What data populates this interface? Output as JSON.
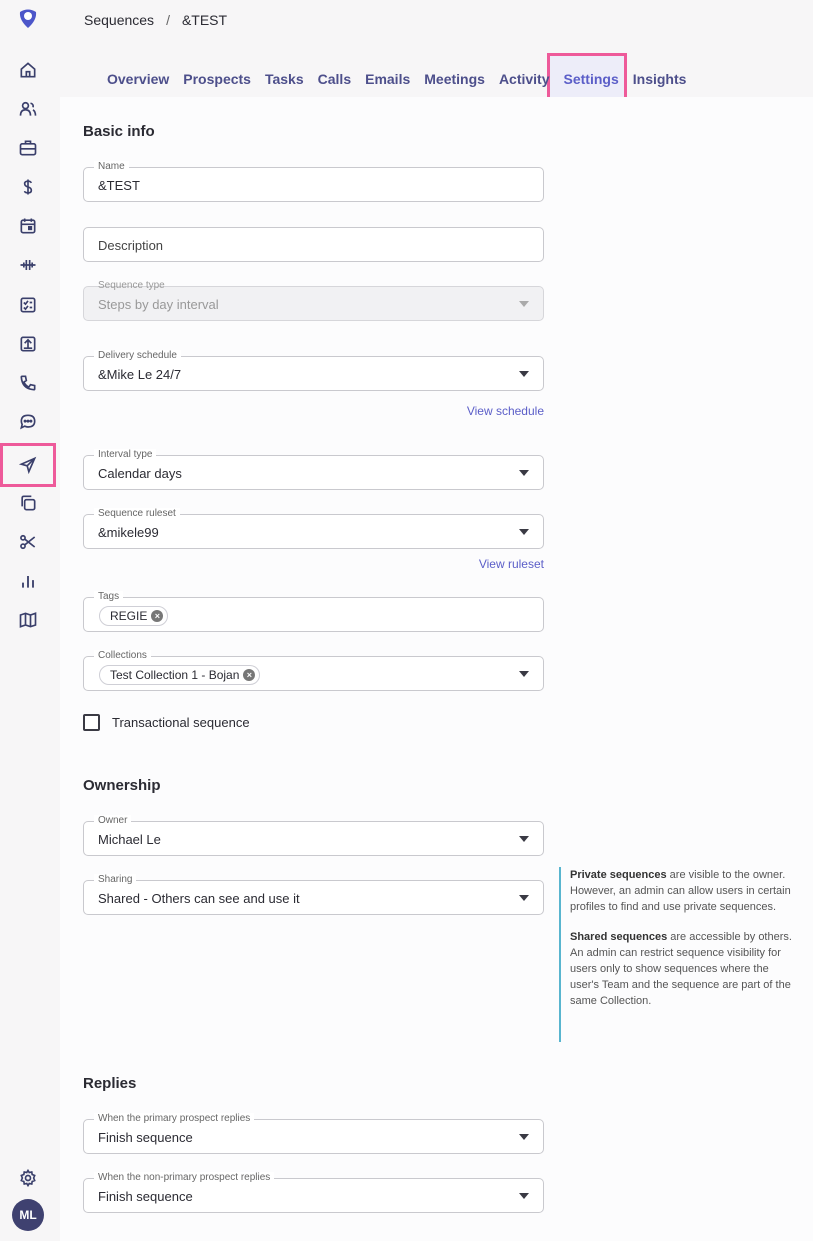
{
  "breadcrumb": {
    "root": "Sequences",
    "separator": "/",
    "current": "&TEST"
  },
  "tabs": [
    "Overview",
    "Prospects",
    "Tasks",
    "Calls",
    "Emails",
    "Meetings",
    "Activity",
    "Settings",
    "Insights"
  ],
  "active_tab": "Settings",
  "rail": {
    "icons": [
      "home-icon",
      "people-icon",
      "briefcase-icon",
      "dollar-icon",
      "calendar-icon",
      "waveform-icon",
      "checklist-icon",
      "upload-icon",
      "phone-icon",
      "chat-icon",
      "send-icon",
      "copy-icon",
      "scissors-icon",
      "bar-chart-icon",
      "map-icon"
    ],
    "active_icon": "send-icon",
    "settings_icon": "gear-icon",
    "avatar_initials": "ML"
  },
  "basic_info": {
    "title": "Basic info",
    "name": {
      "label": "Name",
      "value": "&TEST"
    },
    "description": {
      "placeholder": "Description"
    },
    "sequence_type": {
      "label": "Sequence type",
      "value": "Steps by day interval"
    },
    "delivery_schedule": {
      "label": "Delivery schedule",
      "value": "&Mike Le 24/7"
    },
    "view_schedule": "View schedule",
    "interval_type": {
      "label": "Interval type",
      "value": "Calendar days"
    },
    "sequence_ruleset": {
      "label": "Sequence ruleset",
      "value": "&mikele99"
    },
    "view_ruleset": "View ruleset",
    "tags": {
      "label": "Tags",
      "chips": [
        "REGIE"
      ]
    },
    "collections": {
      "label": "Collections",
      "chips": [
        "Test Collection 1 - Bojan"
      ]
    },
    "transactional": {
      "label": "Transactional sequence",
      "checked": false
    }
  },
  "ownership": {
    "title": "Ownership",
    "owner": {
      "label": "Owner",
      "value": "Michael Le"
    },
    "sharing": {
      "label": "Sharing",
      "value": "Shared - Others can see and use it"
    },
    "help": {
      "private_bold": "Private sequences",
      "private_text": " are visible to the owner. However, an admin can allow users in certain profiles to find and use private sequences.",
      "shared_bold": "Shared sequences",
      "shared_text": " are accessible by others. An admin can restrict sequence visibility for users only to show sequences where the user's Team and the sequence are part of the same Collection."
    }
  },
  "replies": {
    "title": "Replies",
    "primary": {
      "label": "When the primary prospect replies",
      "value": "Finish sequence"
    },
    "non_primary": {
      "label": "When the non-primary prospect replies",
      "value": "Finish sequence"
    }
  },
  "colors": {
    "accent": "#5b5ec8",
    "highlight": "#ee5a9a",
    "help_border": "#58b5cf"
  }
}
